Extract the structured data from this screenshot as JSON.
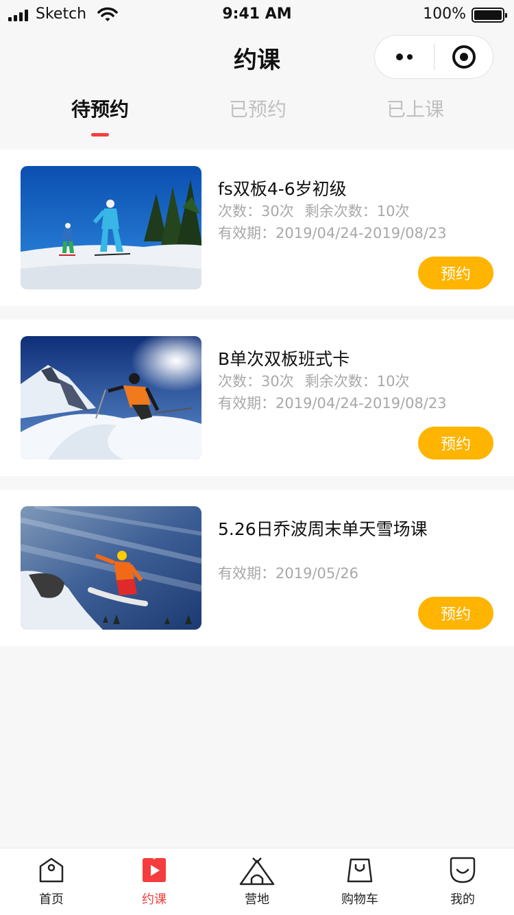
{
  "status_bar": {
    "carrier": "Sketch",
    "time": "9:41 AM",
    "battery": "100%"
  },
  "nav": {
    "title": "约课"
  },
  "tabs": [
    {
      "label": "待预约",
      "active": true
    },
    {
      "label": "已预约",
      "active": false
    },
    {
      "label": "已上课",
      "active": false
    }
  ],
  "courses": [
    {
      "title": "fs双板4-6岁初级",
      "times": "次数：30次",
      "remaining": "剩余次数：10次",
      "validity": "有效期：2019/04/24-2019/08/23",
      "button": "预约",
      "image": "ski-parent-child-photo"
    },
    {
      "title": "B单次双板班式卡",
      "times": "次数：30次",
      "remaining": "剩余次数：10次",
      "validity": "有效期：2019/04/24-2019/08/23",
      "button": "预约",
      "image": "skier-powder-photo"
    },
    {
      "title": "5.26日乔波周末单天雪场课",
      "validity": "有效期：2019/05/26",
      "button": "预约",
      "image": "snowboarder-jump-photo"
    }
  ],
  "tabbar": [
    {
      "label": "首页",
      "icon": "home-tag-icon",
      "active": false
    },
    {
      "label": "约课",
      "icon": "course-book-icon",
      "active": true
    },
    {
      "label": "营地",
      "icon": "tent-icon",
      "active": false
    },
    {
      "label": "购物车",
      "icon": "shopping-bag-icon",
      "active": false
    },
    {
      "label": "我的",
      "icon": "smile-face-icon",
      "active": false
    }
  ],
  "colors": {
    "accent": "#f53d3d",
    "button": "#ffb400",
    "background": "#f7f7f7"
  }
}
